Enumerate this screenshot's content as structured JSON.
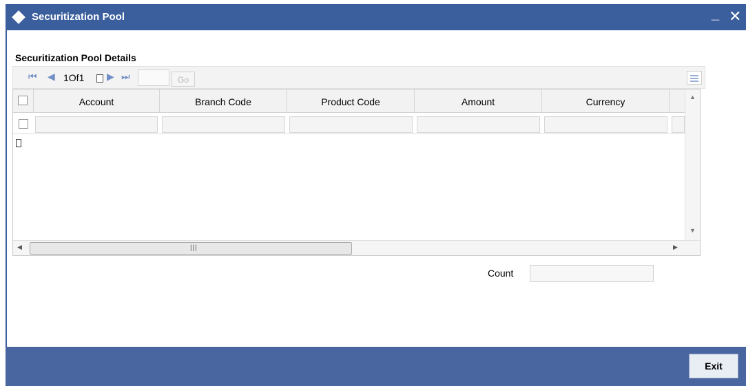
{
  "window": {
    "title": "Securitization Pool",
    "minimize_label": "_",
    "close_label": "✕"
  },
  "section": {
    "title": "Securitization Pool Details"
  },
  "pagination": {
    "current": "1",
    "of_label": "Of",
    "total": "1",
    "go_label": "Go",
    "page_input_value": ""
  },
  "grid": {
    "columns": [
      "Account",
      "Branch Code",
      "Product Code",
      "Amount",
      "Currency"
    ]
  },
  "summary": {
    "count_label": "Count",
    "count_value": ""
  },
  "footer": {
    "exit_label": "Exit"
  },
  "icons": {
    "first": "first-page-icon",
    "prev": "prev-page-icon",
    "next": "next-page-icon",
    "last": "last-page-icon",
    "columns": "column-settings-icon"
  },
  "colors": {
    "title_bar": "#3b5f9d",
    "footer": "#4a66a0",
    "nav_icons": "#6f8fc6"
  }
}
